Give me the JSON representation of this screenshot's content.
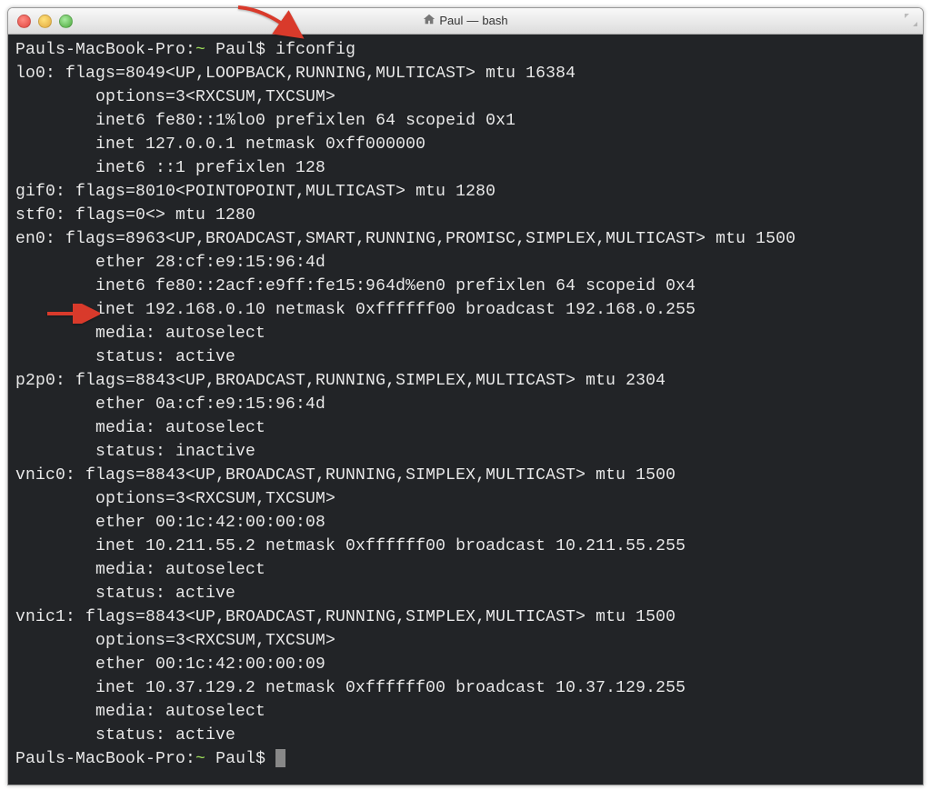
{
  "window": {
    "title_user": "Paul",
    "title_sep": " — ",
    "title_shell": "bash"
  },
  "term": {
    "prompt1_host": "Pauls-MacBook-Pro:",
    "prompt1_path": "~",
    "prompt1_user": " Paul$ ",
    "cmd": "ifconfig",
    "l01": "lo0: flags=8049<UP,LOOPBACK,RUNNING,MULTICAST> mtu 16384",
    "l02": "        options=3<RXCSUM,TXCSUM>",
    "l03": "        inet6 fe80::1%lo0 prefixlen 64 scopeid 0x1",
    "l04": "        inet 127.0.0.1 netmask 0xff000000",
    "l05": "        inet6 ::1 prefixlen 128",
    "l06": "gif0: flags=8010<POINTOPOINT,MULTICAST> mtu 1280",
    "l07": "stf0: flags=0<> mtu 1280",
    "l08": "en0: flags=8963<UP,BROADCAST,SMART,RUNNING,PROMISC,SIMPLEX,MULTICAST> mtu 1500",
    "l09": "        ether 28:cf:e9:15:96:4d",
    "l10": "        inet6 fe80::2acf:e9ff:fe15:964d%en0 prefixlen 64 scopeid 0x4",
    "l11": "        inet 192.168.0.10 netmask 0xffffff00 broadcast 192.168.0.255",
    "l12": "        media: autoselect",
    "l13": "        status: active",
    "l14": "p2p0: flags=8843<UP,BROADCAST,RUNNING,SIMPLEX,MULTICAST> mtu 2304",
    "l15": "        ether 0a:cf:e9:15:96:4d",
    "l16": "        media: autoselect",
    "l17": "        status: inactive",
    "l18": "vnic0: flags=8843<UP,BROADCAST,RUNNING,SIMPLEX,MULTICAST> mtu 1500",
    "l19": "        options=3<RXCSUM,TXCSUM>",
    "l20": "        ether 00:1c:42:00:00:08",
    "l21": "        inet 10.211.55.2 netmask 0xffffff00 broadcast 10.211.55.255",
    "l22": "        media: autoselect",
    "l23": "        status: active",
    "l24": "vnic1: flags=8843<UP,BROADCAST,RUNNING,SIMPLEX,MULTICAST> mtu 1500",
    "l25": "        options=3<RXCSUM,TXCSUM>",
    "l26": "        ether 00:1c:42:00:00:09",
    "l27": "        inet 10.37.129.2 netmask 0xffffff00 broadcast 10.37.129.255",
    "l28": "        media: autoselect",
    "l29": "        status: active",
    "prompt2_host": "Pauls-MacBook-Pro:",
    "prompt2_path": "~",
    "prompt2_user": " Paul$ "
  },
  "colors": {
    "arrow": "#d93a2b"
  }
}
